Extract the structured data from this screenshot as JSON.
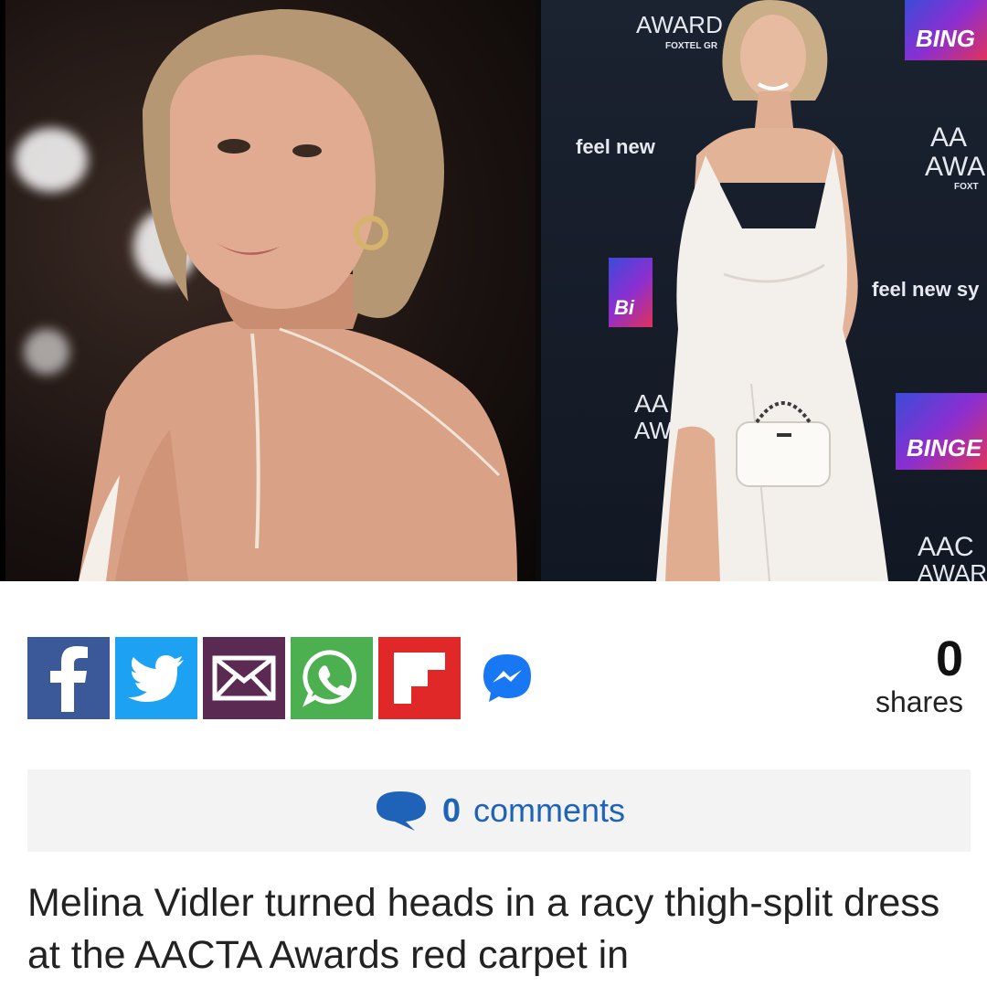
{
  "hero": {
    "backdrop": {
      "award_top": "AWARD",
      "foxtel_top": "FOXTEL GR",
      "binge_top": "BING",
      "feel_new_1": "feel new",
      "aa_1": "AA",
      "awa_1": "AWA",
      "foxt": "FOXT",
      "feel_new_2": "feel new sy",
      "bi": "Bi",
      "aa_2": "AA",
      "aw_2": "AW",
      "binge_mid": "BINGE",
      "aac": "AAC",
      "awar": "AWAR"
    }
  },
  "share": {
    "buttons": [
      {
        "network": "facebook",
        "icon": "facebook-icon",
        "color": "#3b5998"
      },
      {
        "network": "twitter",
        "icon": "twitter-bird-icon",
        "color": "#1da1f2"
      },
      {
        "network": "email",
        "icon": "envelope-icon",
        "color": "#5a2a52"
      },
      {
        "network": "whatsapp",
        "icon": "whatsapp-icon",
        "color": "#4caf50"
      },
      {
        "network": "flipboard",
        "icon": "flipboard-icon",
        "color": "#e12828"
      },
      {
        "network": "messenger",
        "icon": "messenger-icon",
        "color": "#0084ff"
      }
    ],
    "count": "0",
    "count_label": "shares"
  },
  "comments": {
    "icon": "speech-bubble-icon",
    "count": "0",
    "label": "comments",
    "color": "#1f63b8"
  },
  "article": {
    "lead": "Melina Vidler turned heads in a racy thigh-split dress at the AACTA Awards red carpet in"
  }
}
